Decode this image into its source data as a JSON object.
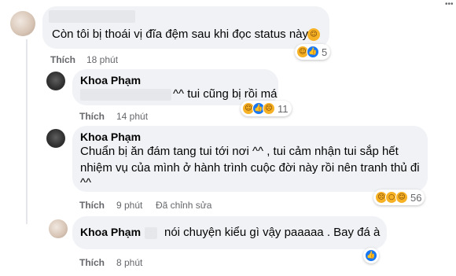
{
  "comments": [
    {
      "author": "",
      "text": "Còn tôi bị thoái vị đĩa đệm sau khi đọc status này",
      "like_label": "Thích",
      "time": "18 phút",
      "reaction_count": "5"
    },
    {
      "author": "Khoa Phạm",
      "text": "^^ tui cũng bị rồi má",
      "like_label": "Thích",
      "time": "14 phút",
      "reaction_count": "11"
    },
    {
      "author": "Khoa Phạm",
      "lines": [
        "Chuẩn bị ăn đám tang tui tới nơi ^^ , tui cảm nhận tui sắp hết",
        "nhiệm vụ của mình ở hành trình cuộc đời này rồi nên tranh thủ đi",
        "^^"
      ],
      "like_label": "Thích",
      "time": "9 phút",
      "edited": "Đã chỉnh sửa",
      "reaction_count": "56"
    },
    {
      "author": "Khoa Phạm",
      "text": "nói chuyện kiểu gì vậy paaaaa . Bay đá à",
      "like_label": "Thích",
      "time": "8 phút"
    }
  ],
  "icons": {
    "haha": "haha-reaction-icon",
    "like": "like-reaction-icon",
    "sad": "sad-reaction-icon",
    "wow": "wow-reaction-icon"
  },
  "colors": {
    "bubble": "#f0f2f5",
    "meta": "#65676b",
    "like_blue": "#1877f2",
    "reaction_yellow": "#f7b125"
  }
}
